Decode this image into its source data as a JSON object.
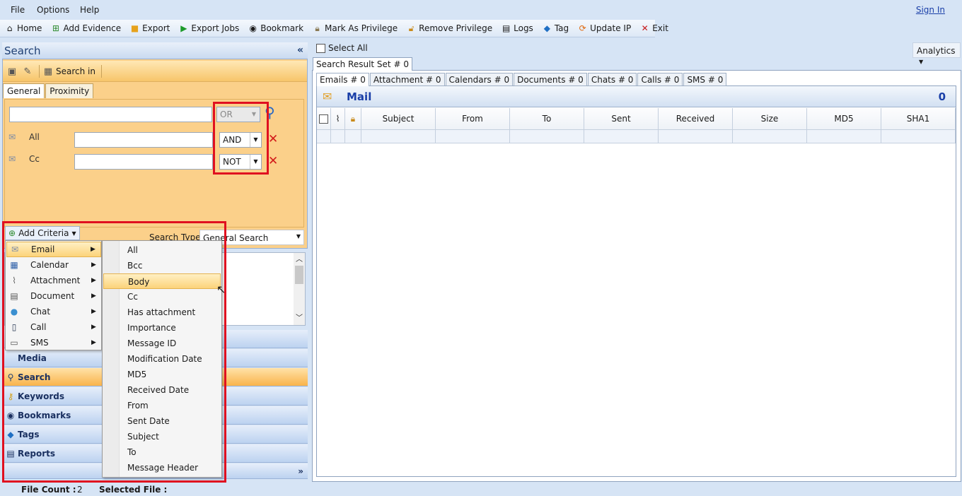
{
  "menubar": {
    "items": [
      "File",
      "Options",
      "Help"
    ],
    "signin": "Sign In"
  },
  "toolbar": {
    "home": "Home",
    "add_evidence": "Add Evidence",
    "export": "Export",
    "export_jobs": "Export Jobs",
    "bookmark": "Bookmark",
    "mark_privilege": "Mark As Privilege",
    "remove_privilege": "Remove Privilege",
    "logs": "Logs",
    "tag": "Tag",
    "update_ip": "Update IP",
    "exit": "Exit"
  },
  "search_panel": {
    "title": "Search",
    "search_in": "Search in",
    "tabs": [
      "General",
      "Proximity"
    ],
    "first_operator": "OR",
    "rows": [
      {
        "label": "All",
        "operator": "AND"
      },
      {
        "label": "Cc",
        "operator": "NOT"
      }
    ],
    "add_criteria": "Add Criteria",
    "search_type_label": "Search Type",
    "search_type_value": "General Search"
  },
  "category_menu": {
    "items": [
      "Email",
      "Calendar",
      "Attachment",
      "Document",
      "Chat",
      "Call",
      "SMS"
    ],
    "highlighted": "Email"
  },
  "field_menu": {
    "items": [
      "All",
      "Bcc",
      "Body",
      "Cc",
      "Has attachment",
      "Importance",
      "Message ID",
      "Modification Date",
      "MD5",
      "Received Date",
      "From",
      "Sent Date",
      "Subject",
      "To",
      "Message Header"
    ],
    "highlighted": "Body"
  },
  "nav": {
    "items": [
      "Media",
      "Search",
      "Keywords",
      "Bookmarks",
      "Tags",
      "Reports"
    ],
    "active": "Search"
  },
  "status": {
    "file_count_label": "File Count :",
    "file_count_value": "2",
    "selected_file_label": "Selected File :"
  },
  "right": {
    "select_all": "Select All",
    "analytics": "Analytics",
    "result_tab": "Search Result Set # 0",
    "sub_tabs": [
      "Emails # 0",
      "Attachment # 0",
      "Calendars # 0",
      "Documents # 0",
      "Chats # 0",
      "Calls # 0",
      "SMS # 0"
    ],
    "mail_title": "Mail",
    "mail_count": "0",
    "columns": [
      "Subject",
      "From",
      "To",
      "Sent",
      "Received",
      "Size",
      "MD5",
      "SHA1"
    ]
  },
  "colors": {
    "accent_blue": "#1a3fa8",
    "panel_orange": "#fbd08a",
    "highlight_red": "#e01020"
  }
}
